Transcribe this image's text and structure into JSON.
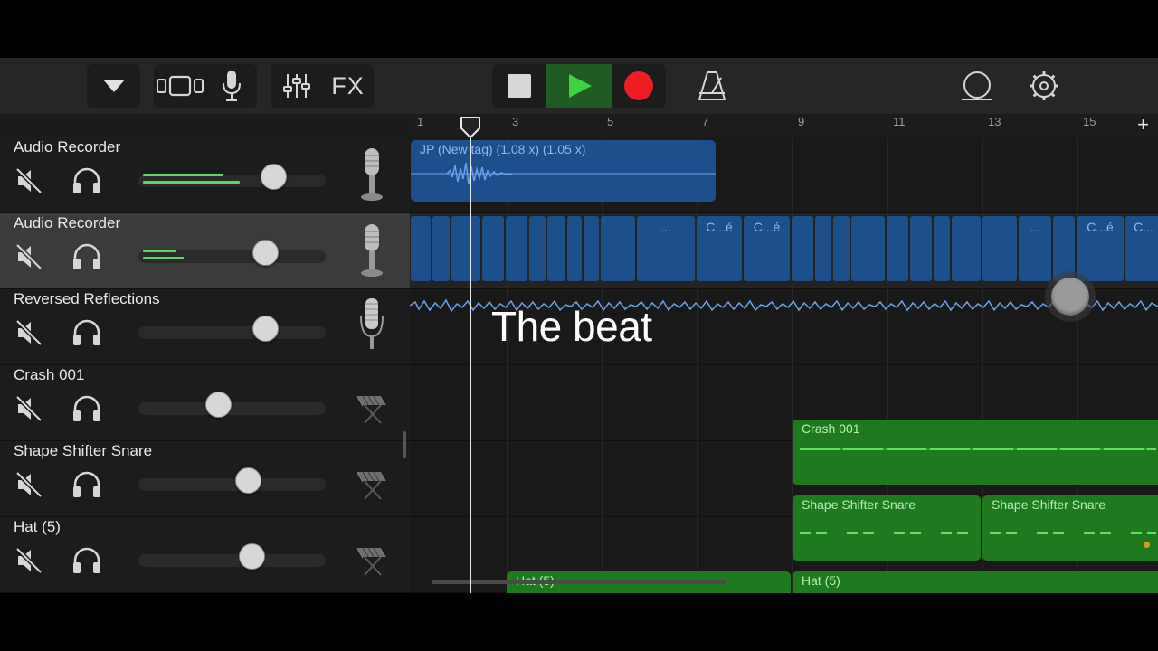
{
  "toolbar": {
    "tracks_menu_icon": "triangle-down-icon",
    "views": [
      "tracks-view-icon",
      "microphone-icon"
    ],
    "mixer_icon": "mixer-sliders-icon",
    "fx_label": "FX",
    "transport": {
      "stop": "stop-icon",
      "play": "play-icon",
      "record": "record-icon"
    },
    "metronome_icon": "metronome-icon",
    "loop_icon": "loop-browser-icon",
    "settings_icon": "settings-gear-icon",
    "colors": {
      "play_active": "#1f5b22",
      "play_icon": "#3fd33f",
      "record": "#ee1c25"
    }
  },
  "ruler": {
    "bar_numbers": [
      "1",
      "3",
      "5",
      "7",
      "9",
      "11",
      "13",
      "15"
    ],
    "add_label": "+"
  },
  "tracks": [
    {
      "name": "Audio Recorder",
      "selected": false,
      "instrument": "microphone",
      "volume": 0.72,
      "meter": [
        0.43,
        0.53
      ]
    },
    {
      "name": "Audio Recorder",
      "selected": true,
      "instrument": "microphone",
      "volume": 0.67,
      "meter": [
        0.22,
        0.23
      ]
    },
    {
      "name": "Reversed Reflections",
      "selected": false,
      "instrument": "condenser-microphone",
      "volume": 0.67,
      "meter": null
    },
    {
      "name": "Crash 001",
      "selected": false,
      "instrument": "keyboard",
      "volume": 0.42,
      "meter": null
    },
    {
      "name": "Shape Shifter Snare",
      "selected": false,
      "instrument": "keyboard",
      "volume": 0.58,
      "meter": null
    },
    {
      "name": "Hat (5)",
      "selected": false,
      "instrument": "keyboard",
      "volume": 0.6,
      "meter": null
    }
  ],
  "regions": {
    "audio1": "JP (New tag) (1.08 x) (1.05 x)",
    "audio2_labels": [
      "...",
      "C...é",
      "C...é",
      "...",
      "C...é",
      "C..."
    ],
    "crash": "Crash 001",
    "snare": [
      "Shape Shifter Snare",
      "Shape Shifter Snare"
    ],
    "hat": [
      "Hat (5)",
      "Hat (5)"
    ]
  },
  "caption": "The beat"
}
